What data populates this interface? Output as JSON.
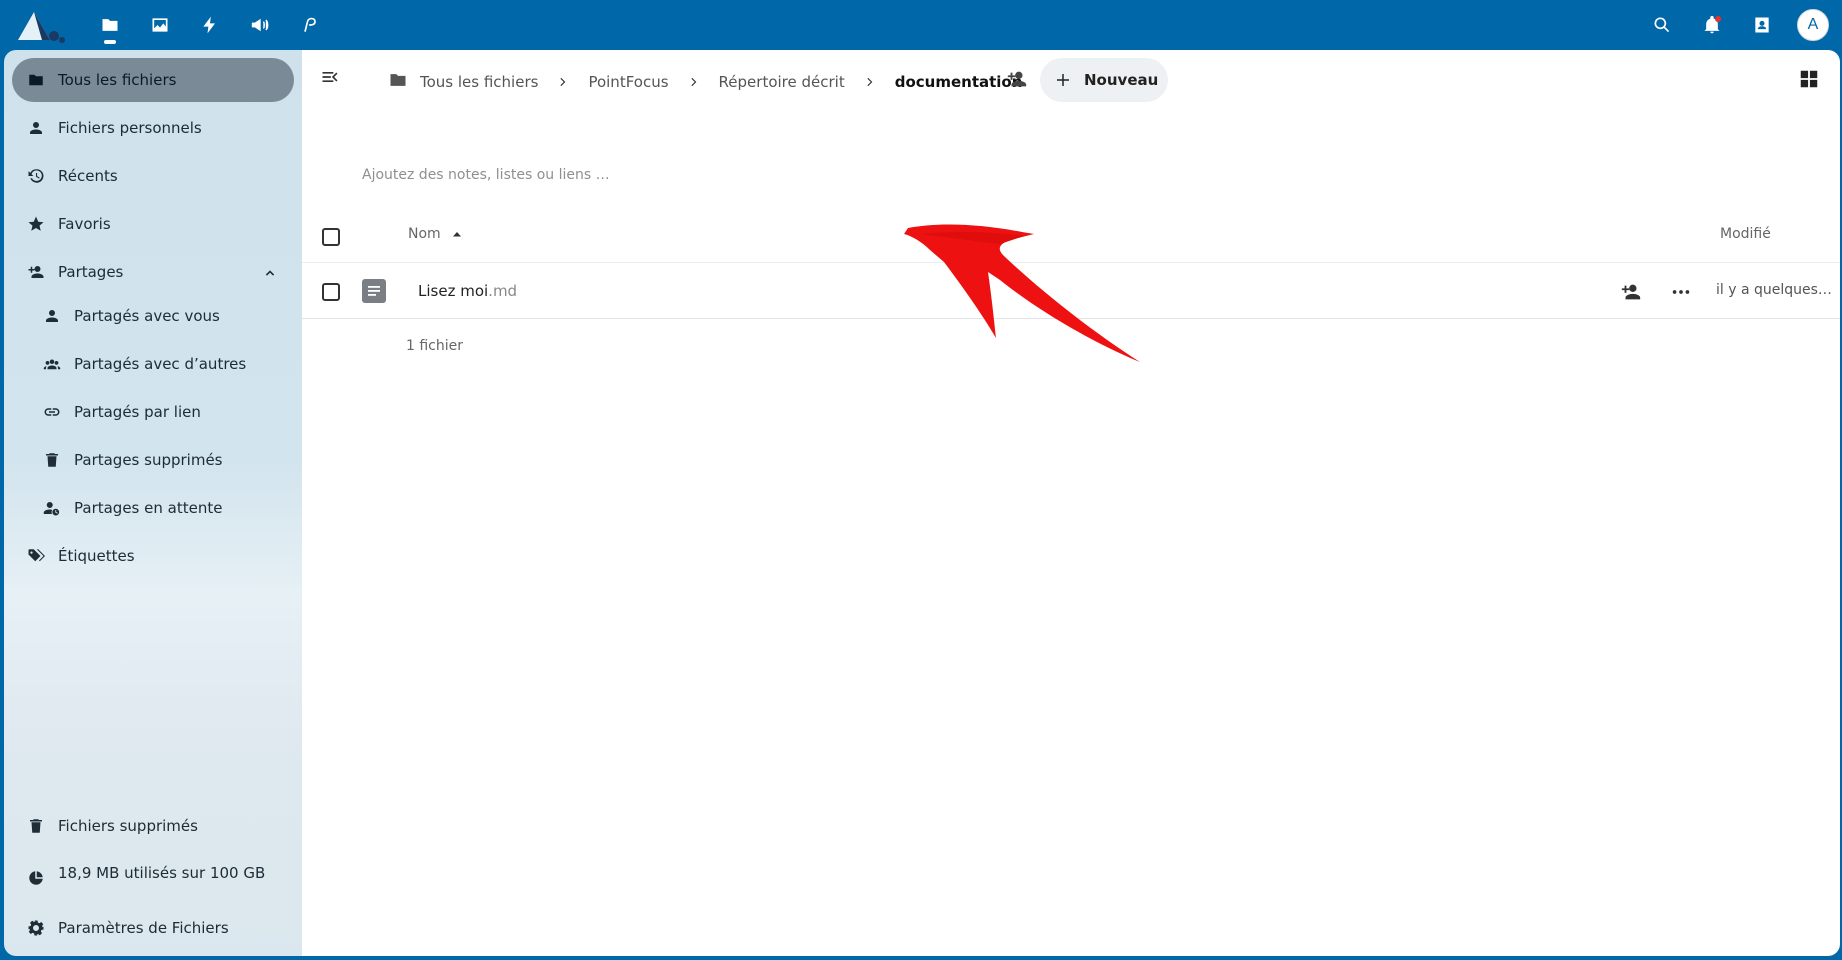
{
  "header": {
    "apps": [
      "files-icon",
      "photos-icon",
      "activity-icon",
      "announcements-icon",
      "flow-icon"
    ],
    "avatar_initial": "A"
  },
  "sidebar": {
    "items": [
      {
        "label": "Tous les fichiers",
        "icon": "folder-icon"
      },
      {
        "label": "Fichiers personnels",
        "icon": "person-icon"
      },
      {
        "label": "Récents",
        "icon": "history-icon"
      },
      {
        "label": "Favoris",
        "icon": "star-icon"
      },
      {
        "label": "Partages",
        "icon": "share-icon"
      },
      {
        "label": "Partagés avec vous",
        "icon": "person-icon"
      },
      {
        "label": "Partagés avec d’autres",
        "icon": "group-icon"
      },
      {
        "label": "Partagés par lien",
        "icon": "link-icon"
      },
      {
        "label": "Partages supprimés",
        "icon": "trash-icon"
      },
      {
        "label": "Partages en attente",
        "icon": "pending-share-icon"
      },
      {
        "label": "Étiquettes",
        "icon": "tag-icon"
      }
    ],
    "footer": {
      "trash": "Fichiers supprimés",
      "quota": "18,9 MB utilisés sur 100 GB",
      "settings": "Paramètres de Fichiers"
    }
  },
  "main": {
    "breadcrumb": [
      "Tous les fichiers",
      "PointFocus",
      "Répertoire décrit",
      "documentation"
    ],
    "new_label": "Nouveau",
    "notes_placeholder": "Ajoutez des notes, listes ou liens …",
    "columns": {
      "name": "Nom",
      "modified": "Modifié"
    },
    "files": [
      {
        "base": "Lisez moi",
        "ext": ".md",
        "modified": "il y a quelques…"
      }
    ],
    "file_count": "1 fichier"
  },
  "colors": {
    "header": "#0067a8",
    "active_nav": "#7a8a96",
    "annotation_arrow": "#ee1111"
  }
}
